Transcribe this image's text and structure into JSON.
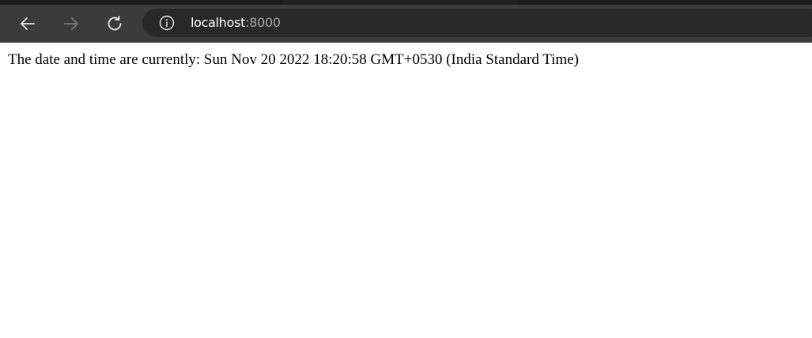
{
  "browser": {
    "address_bar": {
      "host": "localhost",
      "port": ":8000"
    },
    "icons": {
      "back": "back-arrow-icon",
      "forward": "forward-arrow-icon",
      "reload": "reload-icon",
      "site_info": "info-icon"
    },
    "colors": {
      "toolbar": "#3b3b3b",
      "omnibox": "#282828",
      "port_text": "#a6a6a6"
    }
  },
  "page": {
    "message": "The date and time are currently: Sun Nov 20 2022 18:20:58 GMT+0530 (India Standard Time)"
  }
}
